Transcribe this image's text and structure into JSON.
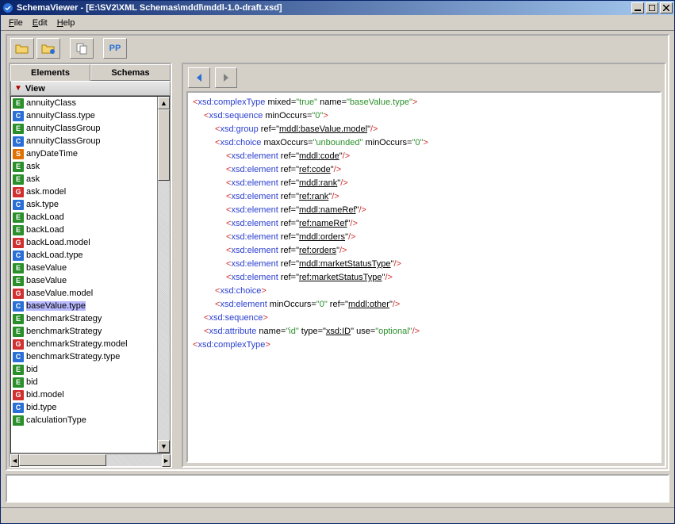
{
  "window": {
    "title": "SchemaViewer - [E:\\SV2\\XML Schemas\\mddl\\mddl-1.0-draft.xsd]"
  },
  "menu": {
    "file": "File",
    "edit": "Edit",
    "help": "Help"
  },
  "toolbar": {
    "open_label": "Open",
    "openrecent_label": "Open",
    "copy_label": "Copy",
    "pp_label": "PP"
  },
  "left": {
    "tabs": {
      "elements": "Elements",
      "schemas": "Schemas"
    },
    "view": "View",
    "items": [
      {
        "t": "E",
        "l": "annuityClass"
      },
      {
        "t": "C",
        "l": "annuityClass.type"
      },
      {
        "t": "E",
        "l": "annuityClassGroup"
      },
      {
        "t": "C",
        "l": "annuityClassGroup"
      },
      {
        "t": "S",
        "l": "anyDateTime"
      },
      {
        "t": "E",
        "l": "ask"
      },
      {
        "t": "E",
        "l": "ask"
      },
      {
        "t": "G",
        "l": "ask.model"
      },
      {
        "t": "C",
        "l": "ask.type"
      },
      {
        "t": "E",
        "l": "backLoad"
      },
      {
        "t": "E",
        "l": "backLoad"
      },
      {
        "t": "G",
        "l": "backLoad.model"
      },
      {
        "t": "C",
        "l": "backLoad.type"
      },
      {
        "t": "E",
        "l": "baseValue"
      },
      {
        "t": "E",
        "l": "baseValue"
      },
      {
        "t": "G",
        "l": "baseValue.model"
      },
      {
        "t": "C",
        "l": "baseValue.type",
        "sel": true
      },
      {
        "t": "E",
        "l": "benchmarkStrategy"
      },
      {
        "t": "E",
        "l": "benchmarkStrategy"
      },
      {
        "t": "G",
        "l": "benchmarkStrategy.model"
      },
      {
        "t": "C",
        "l": "benchmarkStrategy.type"
      },
      {
        "t": "E",
        "l": "bid"
      },
      {
        "t": "E",
        "l": "bid"
      },
      {
        "t": "G",
        "l": "bid.model"
      },
      {
        "t": "C",
        "l": "bid.type"
      },
      {
        "t": "E",
        "l": "calculationType"
      }
    ]
  },
  "code": {
    "lines": [
      {
        "i": 0,
        "p": [
          {
            "c": "pun",
            "t": "<"
          },
          {
            "c": "nm",
            "t": "xsd:complexType"
          },
          {
            "c": "att",
            "t": " mixed="
          },
          {
            "c": "str",
            "t": "\"true\""
          },
          {
            "c": "att",
            "t": " name="
          },
          {
            "c": "str",
            "t": "\"baseValue.type\""
          },
          {
            "c": "pun",
            "t": ">"
          }
        ]
      },
      {
        "i": 1,
        "p": [
          {
            "c": "pun",
            "t": "<"
          },
          {
            "c": "nm",
            "t": "xsd:sequence"
          },
          {
            "c": "att",
            "t": " minOccurs="
          },
          {
            "c": "str",
            "t": "\"0\""
          },
          {
            "c": "pun",
            "t": ">"
          }
        ]
      },
      {
        "i": 2,
        "p": [
          {
            "c": "pun",
            "t": "<"
          },
          {
            "c": "nm",
            "t": "xsd:group"
          },
          {
            "c": "att",
            "t": " ref=\""
          },
          {
            "c": "ref",
            "t": "mddl:baseValue.model"
          },
          {
            "c": "att",
            "t": "\""
          },
          {
            "c": "pun",
            "t": "/>"
          }
        ]
      },
      {
        "i": 2,
        "p": [
          {
            "c": "pun",
            "t": "<"
          },
          {
            "c": "nm",
            "t": "xsd:choice"
          },
          {
            "c": "att",
            "t": " maxOccurs="
          },
          {
            "c": "str",
            "t": "\"unbounded\""
          },
          {
            "c": "att",
            "t": " minOccurs="
          },
          {
            "c": "str",
            "t": "\"0\""
          },
          {
            "c": "pun",
            "t": ">"
          }
        ]
      },
      {
        "i": 3,
        "p": [
          {
            "c": "pun",
            "t": "<"
          },
          {
            "c": "nm",
            "t": "xsd:element"
          },
          {
            "c": "att",
            "t": " ref=\""
          },
          {
            "c": "ref",
            "t": "mddl:code"
          },
          {
            "c": "att",
            "t": "\""
          },
          {
            "c": "pun",
            "t": "/>"
          }
        ]
      },
      {
        "i": 3,
        "p": [
          {
            "c": "pun",
            "t": "<"
          },
          {
            "c": "nm",
            "t": "xsd:element"
          },
          {
            "c": "att",
            "t": " ref=\""
          },
          {
            "c": "ref",
            "t": "ref:code"
          },
          {
            "c": "att",
            "t": "\""
          },
          {
            "c": "pun",
            "t": "/>"
          }
        ]
      },
      {
        "i": 3,
        "p": [
          {
            "c": "pun",
            "t": "<"
          },
          {
            "c": "nm",
            "t": "xsd:element"
          },
          {
            "c": "att",
            "t": " ref=\""
          },
          {
            "c": "ref",
            "t": "mddl:rank"
          },
          {
            "c": "att",
            "t": "\""
          },
          {
            "c": "pun",
            "t": "/>"
          }
        ]
      },
      {
        "i": 3,
        "p": [
          {
            "c": "pun",
            "t": "<"
          },
          {
            "c": "nm",
            "t": "xsd:element"
          },
          {
            "c": "att",
            "t": " ref=\""
          },
          {
            "c": "ref",
            "t": "ref:rank"
          },
          {
            "c": "att",
            "t": "\""
          },
          {
            "c": "pun",
            "t": "/>"
          }
        ]
      },
      {
        "i": 3,
        "p": [
          {
            "c": "pun",
            "t": "<"
          },
          {
            "c": "nm",
            "t": "xsd:element"
          },
          {
            "c": "att",
            "t": " ref=\""
          },
          {
            "c": "ref",
            "t": "mddl:nameRef"
          },
          {
            "c": "att",
            "t": "\""
          },
          {
            "c": "pun",
            "t": "/>"
          }
        ]
      },
      {
        "i": 3,
        "p": [
          {
            "c": "pun",
            "t": "<"
          },
          {
            "c": "nm",
            "t": "xsd:element"
          },
          {
            "c": "att",
            "t": " ref=\""
          },
          {
            "c": "ref",
            "t": "ref:nameRef"
          },
          {
            "c": "att",
            "t": "\""
          },
          {
            "c": "pun",
            "t": "/>"
          }
        ]
      },
      {
        "i": 3,
        "p": [
          {
            "c": "pun",
            "t": "<"
          },
          {
            "c": "nm",
            "t": "xsd:element"
          },
          {
            "c": "att",
            "t": " ref=\""
          },
          {
            "c": "ref",
            "t": "mddl:orders"
          },
          {
            "c": "att",
            "t": "\""
          },
          {
            "c": "pun",
            "t": "/>"
          }
        ]
      },
      {
        "i": 3,
        "p": [
          {
            "c": "pun",
            "t": "<"
          },
          {
            "c": "nm",
            "t": "xsd:element"
          },
          {
            "c": "att",
            "t": " ref=\""
          },
          {
            "c": "ref",
            "t": "ref:orders"
          },
          {
            "c": "att",
            "t": "\""
          },
          {
            "c": "pun",
            "t": "/>"
          }
        ]
      },
      {
        "i": 3,
        "p": [
          {
            "c": "pun",
            "t": "<"
          },
          {
            "c": "nm",
            "t": "xsd:element"
          },
          {
            "c": "att",
            "t": " ref=\""
          },
          {
            "c": "ref",
            "t": "mddl:marketStatusType"
          },
          {
            "c": "att",
            "t": "\""
          },
          {
            "c": "pun",
            "t": "/>"
          }
        ]
      },
      {
        "i": 3,
        "p": [
          {
            "c": "pun",
            "t": "<"
          },
          {
            "c": "nm",
            "t": "xsd:element"
          },
          {
            "c": "att",
            "t": " ref=\""
          },
          {
            "c": "ref",
            "t": "ref:marketStatusType"
          },
          {
            "c": "att",
            "t": "\""
          },
          {
            "c": "pun",
            "t": "/>"
          }
        ]
      },
      {
        "i": 2,
        "p": [
          {
            "c": "pun",
            "t": "<"
          },
          {
            "c": "nm",
            "t": "xsd:choice"
          },
          {
            "c": "pun",
            "t": ">"
          }
        ]
      },
      {
        "i": 2,
        "p": [
          {
            "c": "pun",
            "t": "<"
          },
          {
            "c": "nm",
            "t": "xsd:element"
          },
          {
            "c": "att",
            "t": " minOccurs="
          },
          {
            "c": "str",
            "t": "\"0\""
          },
          {
            "c": "att",
            "t": " ref=\""
          },
          {
            "c": "ref",
            "t": "mddl:other"
          },
          {
            "c": "att",
            "t": "\""
          },
          {
            "c": "pun",
            "t": "/>"
          }
        ]
      },
      {
        "i": 1,
        "p": [
          {
            "c": "pun",
            "t": "<"
          },
          {
            "c": "nm",
            "t": "xsd:sequence"
          },
          {
            "c": "pun",
            "t": ">"
          }
        ]
      },
      {
        "i": 1,
        "p": [
          {
            "c": "pun",
            "t": "<"
          },
          {
            "c": "nm",
            "t": "xsd:attribute"
          },
          {
            "c": "att",
            "t": " name="
          },
          {
            "c": "str",
            "t": "\"id\""
          },
          {
            "c": "att",
            "t": " type=\""
          },
          {
            "c": "ref",
            "t": "xsd:ID"
          },
          {
            "c": "att",
            "t": "\" use="
          },
          {
            "c": "str",
            "t": "\"optional\""
          },
          {
            "c": "pun",
            "t": "/>"
          }
        ]
      },
      {
        "i": 0,
        "p": [
          {
            "c": "pun",
            "t": "<"
          },
          {
            "c": "nm",
            "t": "xsd:complexType"
          },
          {
            "c": "pun",
            "t": ">"
          }
        ]
      }
    ]
  }
}
